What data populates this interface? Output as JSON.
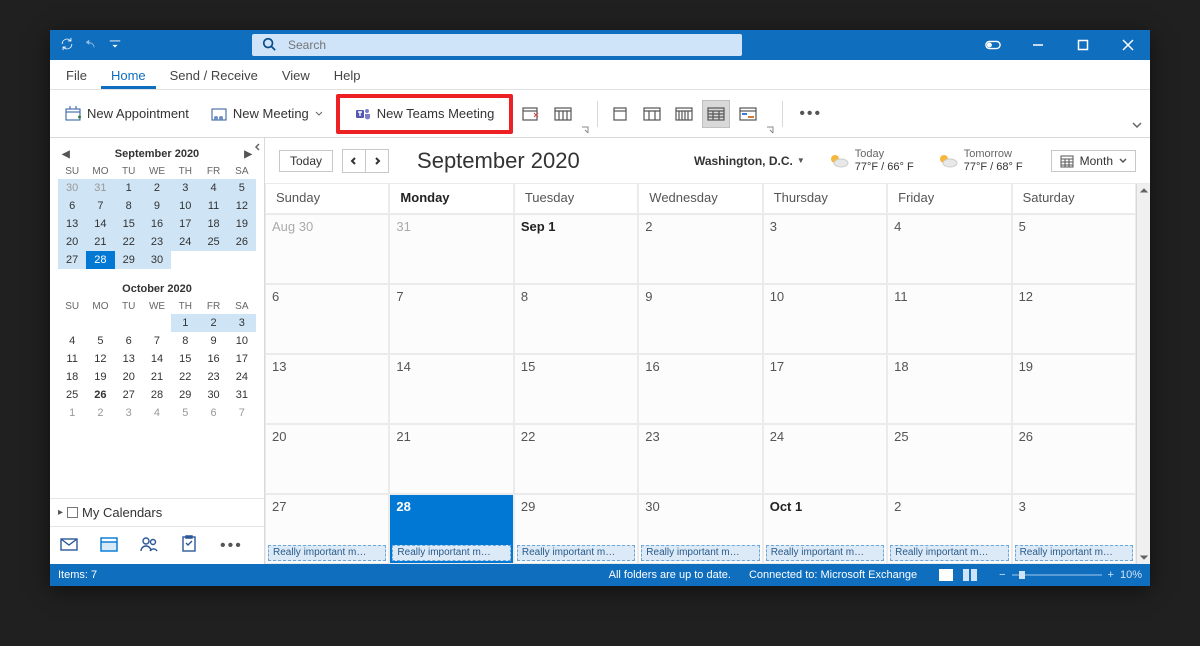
{
  "search": {
    "placeholder": "Search"
  },
  "menubar": {
    "file": "File",
    "home": "Home",
    "send_receive": "Send / Receive",
    "view": "View",
    "help": "Help"
  },
  "ribbon": {
    "new_appointment": "New Appointment",
    "new_meeting": "New Meeting",
    "new_teams_meeting": "New Teams Meeting"
  },
  "sidebar": {
    "month1": {
      "title": "September 2020",
      "dows": [
        "SU",
        "MO",
        "TU",
        "WE",
        "TH",
        "FR",
        "SA"
      ],
      "days": [
        {
          "n": "30",
          "cls": "other hl"
        },
        {
          "n": "31",
          "cls": "other hl"
        },
        {
          "n": "1",
          "cls": "hl"
        },
        {
          "n": "2",
          "cls": "hl"
        },
        {
          "n": "3",
          "cls": "hl"
        },
        {
          "n": "4",
          "cls": "hl"
        },
        {
          "n": "5",
          "cls": "hl"
        },
        {
          "n": "6",
          "cls": "hl"
        },
        {
          "n": "7",
          "cls": "hl"
        },
        {
          "n": "8",
          "cls": "hl"
        },
        {
          "n": "9",
          "cls": "hl"
        },
        {
          "n": "10",
          "cls": "hl"
        },
        {
          "n": "11",
          "cls": "hl"
        },
        {
          "n": "12",
          "cls": "hl"
        },
        {
          "n": "13",
          "cls": "hl"
        },
        {
          "n": "14",
          "cls": "hl"
        },
        {
          "n": "15",
          "cls": "hl"
        },
        {
          "n": "16",
          "cls": "hl"
        },
        {
          "n": "17",
          "cls": "hl"
        },
        {
          "n": "18",
          "cls": "hl"
        },
        {
          "n": "19",
          "cls": "hl"
        },
        {
          "n": "20",
          "cls": "hl"
        },
        {
          "n": "21",
          "cls": "hl"
        },
        {
          "n": "22",
          "cls": "hl"
        },
        {
          "n": "23",
          "cls": "hl"
        },
        {
          "n": "24",
          "cls": "hl"
        },
        {
          "n": "25",
          "cls": "hl"
        },
        {
          "n": "26",
          "cls": "hl"
        },
        {
          "n": "27",
          "cls": "hl"
        },
        {
          "n": "28",
          "cls": "sel"
        },
        {
          "n": "29",
          "cls": "hl"
        },
        {
          "n": "30",
          "cls": "hl"
        },
        {
          "n": "",
          "cls": ""
        },
        {
          "n": "",
          "cls": ""
        },
        {
          "n": "",
          "cls": ""
        }
      ]
    },
    "month2": {
      "title": "October 2020",
      "dows": [
        "SU",
        "MO",
        "TU",
        "WE",
        "TH",
        "FR",
        "SA"
      ],
      "days": [
        {
          "n": "",
          "cls": ""
        },
        {
          "n": "",
          "cls": ""
        },
        {
          "n": "",
          "cls": ""
        },
        {
          "n": "",
          "cls": ""
        },
        {
          "n": "1",
          "cls": "hl"
        },
        {
          "n": "2",
          "cls": "hl"
        },
        {
          "n": "3",
          "cls": "hl"
        },
        {
          "n": "4",
          "cls": ""
        },
        {
          "n": "5",
          "cls": ""
        },
        {
          "n": "6",
          "cls": ""
        },
        {
          "n": "7",
          "cls": ""
        },
        {
          "n": "8",
          "cls": ""
        },
        {
          "n": "9",
          "cls": ""
        },
        {
          "n": "10",
          "cls": ""
        },
        {
          "n": "11",
          "cls": ""
        },
        {
          "n": "12",
          "cls": ""
        },
        {
          "n": "13",
          "cls": ""
        },
        {
          "n": "14",
          "cls": ""
        },
        {
          "n": "15",
          "cls": ""
        },
        {
          "n": "16",
          "cls": ""
        },
        {
          "n": "17",
          "cls": ""
        },
        {
          "n": "18",
          "cls": ""
        },
        {
          "n": "19",
          "cls": ""
        },
        {
          "n": "20",
          "cls": ""
        },
        {
          "n": "21",
          "cls": ""
        },
        {
          "n": "22",
          "cls": ""
        },
        {
          "n": "23",
          "cls": ""
        },
        {
          "n": "24",
          "cls": ""
        },
        {
          "n": "25",
          "cls": ""
        },
        {
          "n": "26",
          "cls": "bold"
        },
        {
          "n": "27",
          "cls": ""
        },
        {
          "n": "28",
          "cls": ""
        },
        {
          "n": "29",
          "cls": ""
        },
        {
          "n": "30",
          "cls": ""
        },
        {
          "n": "31",
          "cls": ""
        },
        {
          "n": "1",
          "cls": "other"
        },
        {
          "n": "2",
          "cls": "other"
        },
        {
          "n": "3",
          "cls": "other"
        },
        {
          "n": "4",
          "cls": "other"
        },
        {
          "n": "5",
          "cls": "other"
        },
        {
          "n": "6",
          "cls": "other"
        },
        {
          "n": "7",
          "cls": "other"
        }
      ]
    },
    "my_calendars": "My Calendars"
  },
  "main": {
    "today_btn": "Today",
    "title": "September 2020",
    "location": "Washington, D.C.",
    "weather": {
      "today_label": "Today",
      "today_temps": "77°F / 66° F",
      "tomorrow_label": "Tomorrow",
      "tomorrow_temps": "77°F / 68° F"
    },
    "view_selector": "Month",
    "dows": [
      "Sunday",
      "Monday",
      "Tuesday",
      "Wednesday",
      "Thursday",
      "Friday",
      "Saturday"
    ],
    "cells": [
      {
        "n": "Aug 30",
        "cls": "other"
      },
      {
        "n": "31",
        "cls": "other"
      },
      {
        "n": "Sep 1",
        "cls": "firstofmonth"
      },
      {
        "n": "2",
        "cls": ""
      },
      {
        "n": "3",
        "cls": ""
      },
      {
        "n": "4",
        "cls": ""
      },
      {
        "n": "5",
        "cls": ""
      },
      {
        "n": "6",
        "cls": ""
      },
      {
        "n": "7",
        "cls": ""
      },
      {
        "n": "8",
        "cls": ""
      },
      {
        "n": "9",
        "cls": ""
      },
      {
        "n": "10",
        "cls": ""
      },
      {
        "n": "11",
        "cls": ""
      },
      {
        "n": "12",
        "cls": ""
      },
      {
        "n": "13",
        "cls": ""
      },
      {
        "n": "14",
        "cls": ""
      },
      {
        "n": "15",
        "cls": ""
      },
      {
        "n": "16",
        "cls": ""
      },
      {
        "n": "17",
        "cls": ""
      },
      {
        "n": "18",
        "cls": ""
      },
      {
        "n": "19",
        "cls": ""
      },
      {
        "n": "20",
        "cls": ""
      },
      {
        "n": "21",
        "cls": ""
      },
      {
        "n": "22",
        "cls": ""
      },
      {
        "n": "23",
        "cls": ""
      },
      {
        "n": "24",
        "cls": ""
      },
      {
        "n": "25",
        "cls": ""
      },
      {
        "n": "26",
        "cls": ""
      },
      {
        "n": "27",
        "cls": "",
        "ev": "Really important m…"
      },
      {
        "n": "28",
        "cls": "selected",
        "ev": "Really important m…"
      },
      {
        "n": "29",
        "cls": "",
        "ev": "Really important m…"
      },
      {
        "n": "30",
        "cls": "",
        "ev": "Really important m…"
      },
      {
        "n": "Oct 1",
        "cls": "firstofmonth",
        "ev": "Really important m…"
      },
      {
        "n": "2",
        "cls": "",
        "ev": "Really important m…"
      },
      {
        "n": "3",
        "cls": "",
        "ev": "Really important m…"
      }
    ]
  },
  "status": {
    "items": "Items: 7",
    "sync": "All folders are up to date.",
    "conn": "Connected to: Microsoft Exchange",
    "zoom": "10%"
  }
}
